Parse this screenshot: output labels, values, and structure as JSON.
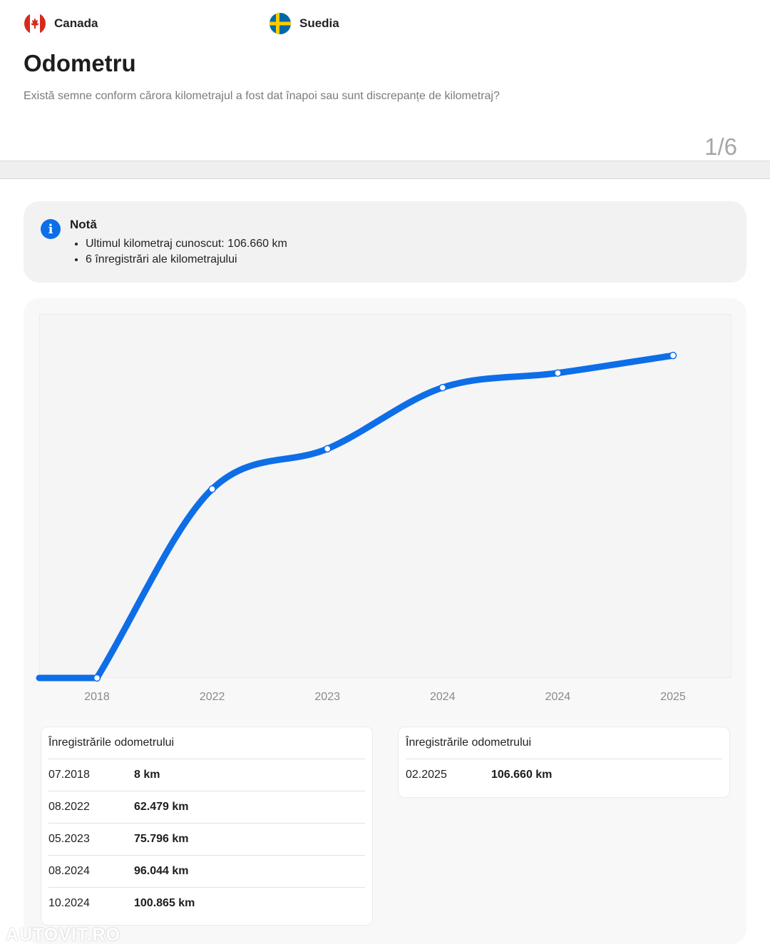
{
  "countries": [
    {
      "name": "Canada"
    },
    {
      "name": "Suedia"
    }
  ],
  "section": {
    "title": "Odometru",
    "subtitle": "Există semne conform cărora kilometrajul a fost dat înapoi sau sunt discrepanțe de kilometraj?",
    "pager": "1/6"
  },
  "note": {
    "title": "Notă",
    "items": [
      "Ultimul kilometraj cunoscut: 106.660 km",
      "6 înregistrări ale kilometrajului"
    ]
  },
  "chart_data": {
    "type": "line",
    "categories": [
      "2018",
      "2022",
      "2023",
      "2024",
      "2024",
      "2025"
    ],
    "values": [
      8,
      62479,
      75796,
      96044,
      100865,
      106660
    ],
    "colors": {
      "line": "#0d6ee8",
      "point_fill": "#ffffff"
    },
    "grid": false
  },
  "records": [
    {
      "heading": "Înregistrările odometrului",
      "rows": [
        {
          "date": "07.2018",
          "km": "8 km"
        },
        {
          "date": "08.2022",
          "km": "62.479 km"
        },
        {
          "date": "05.2023",
          "km": "75.796 km"
        },
        {
          "date": "08.2024",
          "km": "96.044 km"
        },
        {
          "date": "10.2024",
          "km": "100.865 km"
        }
      ]
    },
    {
      "heading": "Înregistrările odometrului",
      "rows": [
        {
          "date": "02.2025",
          "km": "106.660 km"
        }
      ]
    }
  ],
  "watermark": "AUTOVIT.RO"
}
